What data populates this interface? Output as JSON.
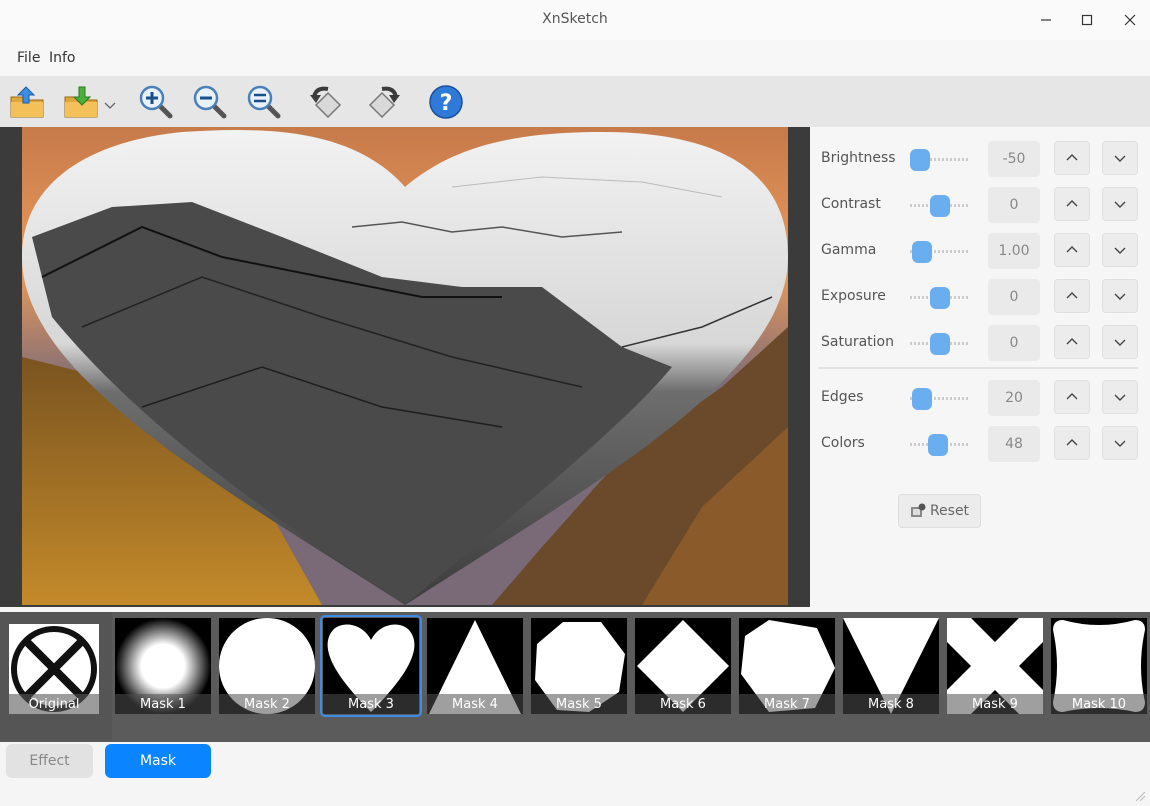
{
  "window": {
    "title": "XnSketch"
  },
  "menu": [
    "File",
    "Info"
  ],
  "toolbar": {
    "icons": [
      "open-folder-icon",
      "save-folder-icon",
      "zoom-in-icon",
      "zoom-out-icon",
      "zoom-fit-icon",
      "rotate-left-icon",
      "rotate-right-icon",
      "help-icon"
    ]
  },
  "adjustments": [
    {
      "label": "Brightness",
      "value": "-50",
      "level": 0.0
    },
    {
      "label": "Contrast",
      "value": "0",
      "level": 0.5
    },
    {
      "label": "Gamma",
      "value": "1.00",
      "level": 0.05
    },
    {
      "label": "Exposure",
      "value": "0",
      "level": 0.5
    },
    {
      "label": "Saturation",
      "value": "0",
      "level": 0.5
    },
    {
      "label": "Edges",
      "value": "20",
      "level": 0.05
    },
    {
      "label": "Colors",
      "value": "48",
      "level": 0.45
    }
  ],
  "reset_label": "Reset",
  "masks": {
    "original_label": "Original",
    "items": [
      "Mask 1",
      "Mask 2",
      "Mask 3",
      "Mask 4",
      "Mask 5",
      "Mask 6",
      "Mask 7",
      "Mask 8",
      "Mask 9",
      "Mask 10"
    ],
    "selected": "Mask 3"
  },
  "tabs": {
    "effect": "Effect",
    "mask": "Mask",
    "active": "Mask"
  },
  "colors": {
    "accent": "#0a84ff",
    "slider": "#6aaef0",
    "selection": "#3a8ee8"
  }
}
